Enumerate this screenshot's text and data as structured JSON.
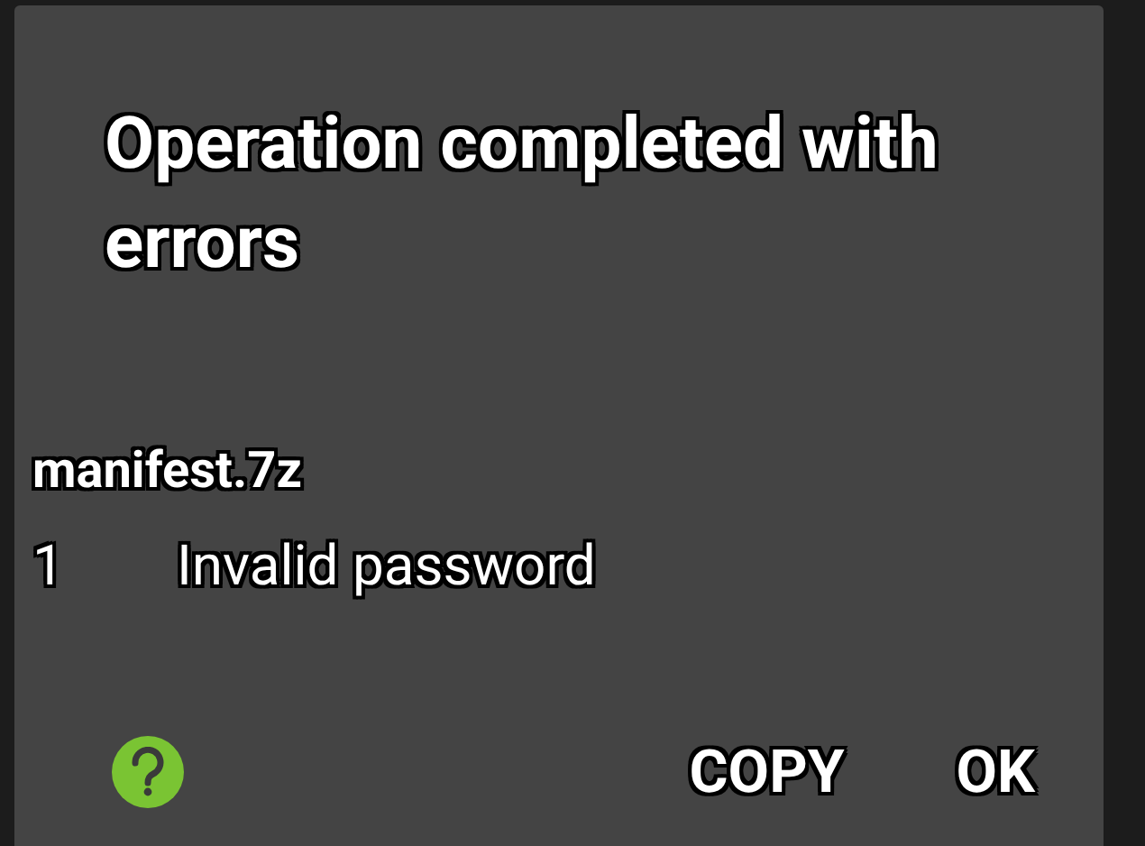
{
  "dialog": {
    "title": "Operation completed with errors",
    "archive": "manifest.7z",
    "errors": [
      {
        "number": "1",
        "message": "Invalid password"
      }
    ],
    "buttons": [
      "COPY",
      "OK"
    ]
  }
}
